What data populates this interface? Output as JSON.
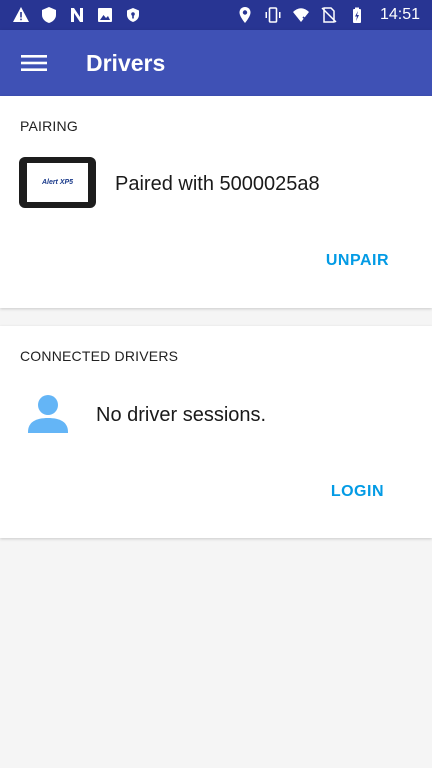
{
  "status_bar": {
    "left_icons": [
      "warning-icon",
      "shield-icon",
      "n-icon",
      "image-icon",
      "shield-small-icon"
    ],
    "right_icons": [
      "location-icon",
      "vibrate-icon",
      "wifi-icon",
      "no-sim-icon",
      "battery-charging-icon"
    ],
    "time": "14:51",
    "color": "#283593"
  },
  "app_bar": {
    "title": "Drivers",
    "menu_icon": "hamburger-menu-icon",
    "color": "#3f51b5"
  },
  "pairing": {
    "section_title": "PAIRING",
    "device_image_text": "Alert XP5",
    "status_text": "Paired with 5000025a8",
    "action_label": "UNPAIR"
  },
  "connected_drivers": {
    "section_title": "CONNECTED DRIVERS",
    "icon": "person-icon",
    "status_text": "No driver sessions.",
    "action_label": "LOGIN"
  },
  "colors": {
    "accent": "#039be5",
    "person_icon": "#64b5f6",
    "background": "#f5f5f5"
  }
}
